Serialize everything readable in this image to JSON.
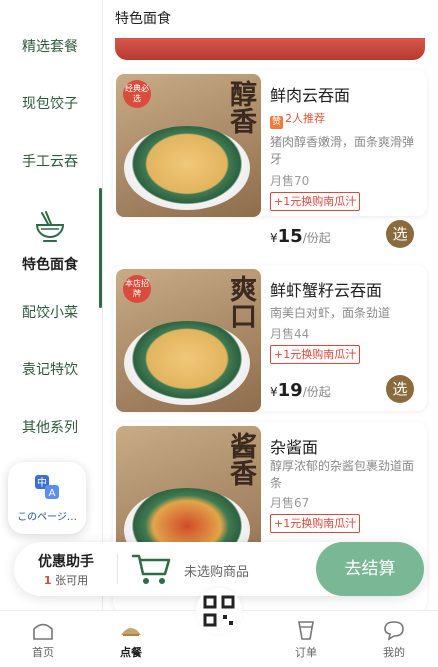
{
  "sidebar": {
    "items": [
      {
        "label": "精选套餐"
      },
      {
        "label": "现包饺子"
      },
      {
        "label": "手工云吞"
      },
      {
        "label": "特色面食"
      },
      {
        "label": "配饺小菜"
      },
      {
        "label": "袁记特饮"
      },
      {
        "label": "其他系列"
      }
    ],
    "active_icon": "noodle-bowl-icon"
  },
  "main": {
    "section_title": "特色面食",
    "products": [
      {
        "name": "鲜肉云吞面",
        "recommend": "2人推荐",
        "description": "猪肉醇香嫩滑，面条爽滑弹牙",
        "sold": "月售70",
        "promo": "+1元换购南瓜汁",
        "currency": "¥",
        "price": "15",
        "unit": "/份起",
        "select_label": "选",
        "image_char": "醇香",
        "image_badge": "经典必选"
      },
      {
        "name": "鲜虾蟹籽云吞面",
        "description": "南美白对虾，面条劲道",
        "sold": "月售44",
        "promo": "+1元换购南瓜汁",
        "currency": "¥",
        "price": "19",
        "unit": "/份起",
        "select_label": "选",
        "image_char": "爽口",
        "image_badge": "本店招牌"
      },
      {
        "name": "杂酱面",
        "description": "醇厚浓郁的杂酱包裹劲道面条",
        "sold": "月售67",
        "promo": "+1元换购南瓜汁",
        "image_char": "酱香"
      }
    ]
  },
  "translate": {
    "label": "このページ…"
  },
  "checkout": {
    "coupon_title": "优惠助手",
    "coupon_count": "1",
    "coupon_unit": "张可用",
    "cart_text": "未选购商品",
    "button_label": "去结算"
  },
  "tabbar": {
    "tabs": [
      {
        "label": "首页"
      },
      {
        "label": "点餐"
      },
      {
        "label": "订单"
      },
      {
        "label": "我的"
      }
    ]
  },
  "colors": {
    "accent_green": "#2f6b45",
    "checkout_green": "#7ab795",
    "promo_red": "#e0473b",
    "select_brown": "#8b6a3e"
  }
}
